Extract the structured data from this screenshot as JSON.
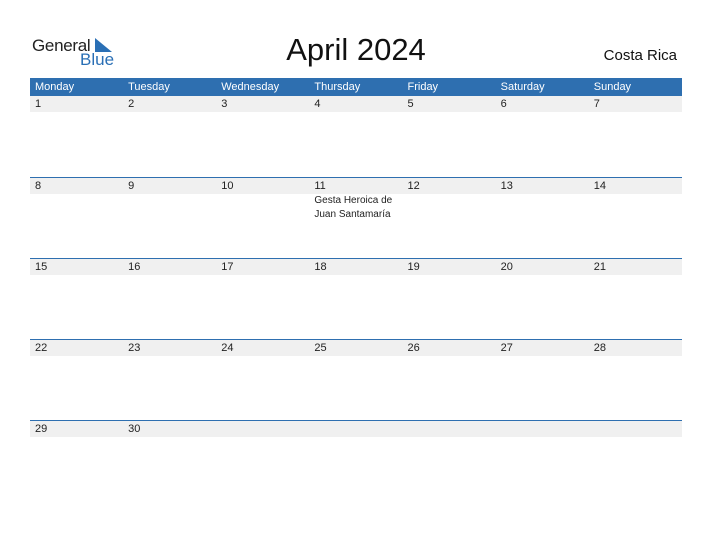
{
  "logo": {
    "general": "General",
    "blue": "Blue"
  },
  "title": "April 2024",
  "country": "Costa Rica",
  "colors": {
    "accent": "#2e6fb0",
    "day_strip": "#f0f0f0"
  },
  "weekdays": [
    "Monday",
    "Tuesday",
    "Wednesday",
    "Thursday",
    "Friday",
    "Saturday",
    "Sunday"
  ],
  "weeks": [
    {
      "days": [
        "1",
        "2",
        "3",
        "4",
        "5",
        "6",
        "7"
      ],
      "events": [
        "",
        "",
        "",
        "",
        "",
        "",
        ""
      ]
    },
    {
      "days": [
        "8",
        "9",
        "10",
        "11",
        "12",
        "13",
        "14"
      ],
      "events": [
        "",
        "",
        "",
        "Gesta Heroica de Juan Santamaría",
        "",
        "",
        ""
      ]
    },
    {
      "days": [
        "15",
        "16",
        "17",
        "18",
        "19",
        "20",
        "21"
      ],
      "events": [
        "",
        "",
        "",
        "",
        "",
        "",
        ""
      ]
    },
    {
      "days": [
        "22",
        "23",
        "24",
        "25",
        "26",
        "27",
        "28"
      ],
      "events": [
        "",
        "",
        "",
        "",
        "",
        "",
        ""
      ]
    },
    {
      "days": [
        "29",
        "30",
        "",
        "",
        "",
        "",
        ""
      ],
      "events": [
        "",
        "",
        "",
        "",
        "",
        "",
        ""
      ]
    }
  ]
}
